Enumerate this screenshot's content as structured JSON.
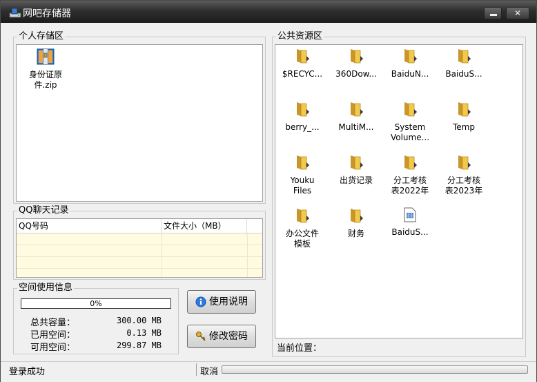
{
  "window": {
    "title": "网吧存储器"
  },
  "personal": {
    "legend": "个人存储区",
    "files": [
      {
        "name_line1": "身份证原",
        "name_line2": "件.zip",
        "icon": "zip-archive-icon"
      }
    ]
  },
  "qq": {
    "legend": "QQ聊天记录",
    "columns": [
      "QQ号码",
      "文件大小（MB）"
    ]
  },
  "space": {
    "legend": "空间使用信息",
    "percent_text": "0%",
    "percent": 0,
    "total_label": "总共容量：",
    "total_value": "300.00 MB",
    "used_label": "已用空间：",
    "used_value": "0.13 MB",
    "free_label": "可用空间：",
    "free_value": "299.87 MB"
  },
  "buttons": {
    "help": "使用说明",
    "change_password": "修改密码"
  },
  "public": {
    "legend": "公共资源区",
    "location_label": "当前位置：",
    "items": [
      {
        "l1": "$RECYC...",
        "l2": "",
        "type": "folder"
      },
      {
        "l1": "360Dow...",
        "l2": "",
        "type": "folder"
      },
      {
        "l1": "BaiduN...",
        "l2": "",
        "type": "folder"
      },
      {
        "l1": "BaiduS...",
        "l2": "",
        "type": "folder"
      },
      {
        "l1": "berry_...",
        "l2": "",
        "type": "folder"
      },
      {
        "l1": "MultiM...",
        "l2": "",
        "type": "folder"
      },
      {
        "l1": "System",
        "l2": "Volume...",
        "type": "folder"
      },
      {
        "l1": "Temp",
        "l2": "",
        "type": "folder"
      },
      {
        "l1": "Youku",
        "l2": "Files",
        "type": "folder"
      },
      {
        "l1": "出货记录",
        "l2": "",
        "type": "folder"
      },
      {
        "l1": "分工考核",
        "l2": "表2022年",
        "type": "folder"
      },
      {
        "l1": "分工考核",
        "l2": "表2023年",
        "type": "folder"
      },
      {
        "l1": "办公文件",
        "l2": "模板",
        "type": "folder"
      },
      {
        "l1": "财务",
        "l2": "",
        "type": "folder"
      },
      {
        "l1": "BaiduS...",
        "l2": "",
        "type": "file"
      }
    ]
  },
  "status": {
    "message": "登录成功",
    "cancel": "取消"
  },
  "colors": {
    "titlebar": "#2f2f2f",
    "folder": "#e8b93a",
    "qq_rows": "#fffbe0"
  }
}
